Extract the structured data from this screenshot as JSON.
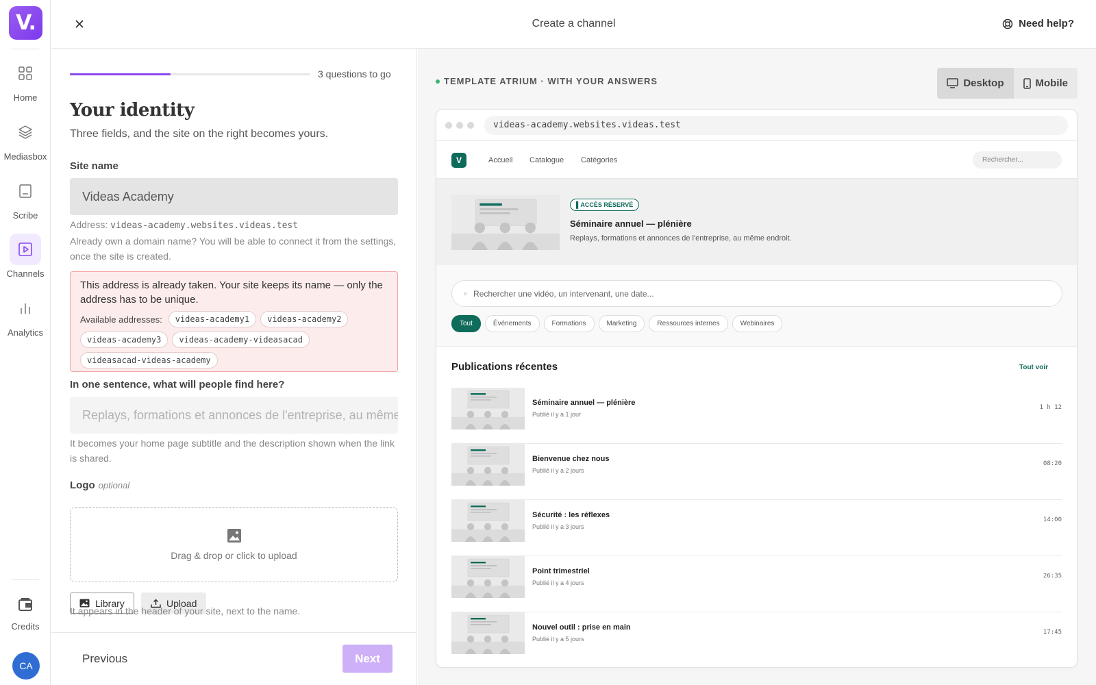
{
  "brand": {
    "logo_text": "V.",
    "accent": "#8b47ee"
  },
  "rail": {
    "items": [
      {
        "label": "Home",
        "icon": "grid-icon"
      },
      {
        "label": "Mediasbox",
        "icon": "layers-icon"
      },
      {
        "label": "Scribe",
        "icon": "document-icon"
      },
      {
        "label": "Channels",
        "icon": "play-square-icon",
        "active": true
      },
      {
        "label": "Analytics",
        "icon": "bar-chart-icon"
      }
    ],
    "credits_label": "Credits",
    "avatar_initials": "CA"
  },
  "header": {
    "title": "Create a channel",
    "help_label": "Need help?"
  },
  "form": {
    "progress_fraction": 0.42,
    "questions_left": "3 questions to go",
    "title": "Your identity",
    "subtitle": "Three fields, and the site on the right becomes yours.",
    "site_name": {
      "label": "Site name",
      "value": "Videas Academy"
    },
    "address": {
      "prefix": "Address: ",
      "value": "videas-academy.websites.videas.test",
      "note": "Already own a domain name? You will be able to connect it from the settings, once the site is created."
    },
    "error": {
      "message": "This address is already taken. Your site keeps its name — only the address has to be unique.",
      "available_label": "Available addresses:",
      "options": [
        "videas-academy1",
        "videas-academy2",
        "videas-academy3",
        "videas-academy-videasacad",
        "videasacad-videas-academy"
      ]
    },
    "sentence": {
      "label": "In one sentence, what will people find here?",
      "placeholder": "Replays, formations et annonces de l'entreprise, au même endroit.",
      "hint": "It becomes your home page subtitle and the description shown when the link is shared."
    },
    "logo": {
      "label": "Logo",
      "optional": "optional",
      "drop_text": "Drag & drop or click to upload",
      "library_label": "Library",
      "upload_label": "Upload",
      "hint": "It appears in the header of your site, next to the name."
    },
    "previous_label": "Previous",
    "next_label": "Next"
  },
  "preview": {
    "template_label": "TEMPLATE ATRIUM · WITH YOUR ANSWERS",
    "desktop_label": "Desktop",
    "mobile_label": "Mobile",
    "url": "videas-academy.websites.videas.test",
    "site": {
      "logo_letter": "V",
      "nav": [
        "Accueil",
        "Catalogue",
        "Catégories"
      ],
      "search_placeholder": "Rechercher...",
      "hero": {
        "badge": "ACCÈS RÉSERVÉ",
        "title": "Séminaire annuel — plénière",
        "desc": "Replays, formations et annonces de l'entreprise, au même endroit."
      },
      "big_search": "Rechercher une vidéo, un intervenant, une date...",
      "categories": [
        "Tout",
        "Événements",
        "Formations",
        "Marketing",
        "Ressources internes",
        "Webinaires"
      ],
      "recent_title": "Publications récentes",
      "see_all": "Tout voir",
      "posts": [
        {
          "title": "Séminaire annuel — plénière",
          "meta": "Publié il y a 1 jour",
          "duration": "1 h 12"
        },
        {
          "title": "Bienvenue chez nous",
          "meta": "Publié il y a 2 jours",
          "duration": "08:20"
        },
        {
          "title": "Sécurité : les réflexes",
          "meta": "Publié il y a 3 jours",
          "duration": "14:00"
        },
        {
          "title": "Point trimestriel",
          "meta": "Publié il y a 4 jours",
          "duration": "26:35"
        },
        {
          "title": "Nouvel outil : prise en main",
          "meta": "Publié il y a 5 jours",
          "duration": "17:45"
        }
      ],
      "theme_color": "#0f6b5a"
    }
  }
}
